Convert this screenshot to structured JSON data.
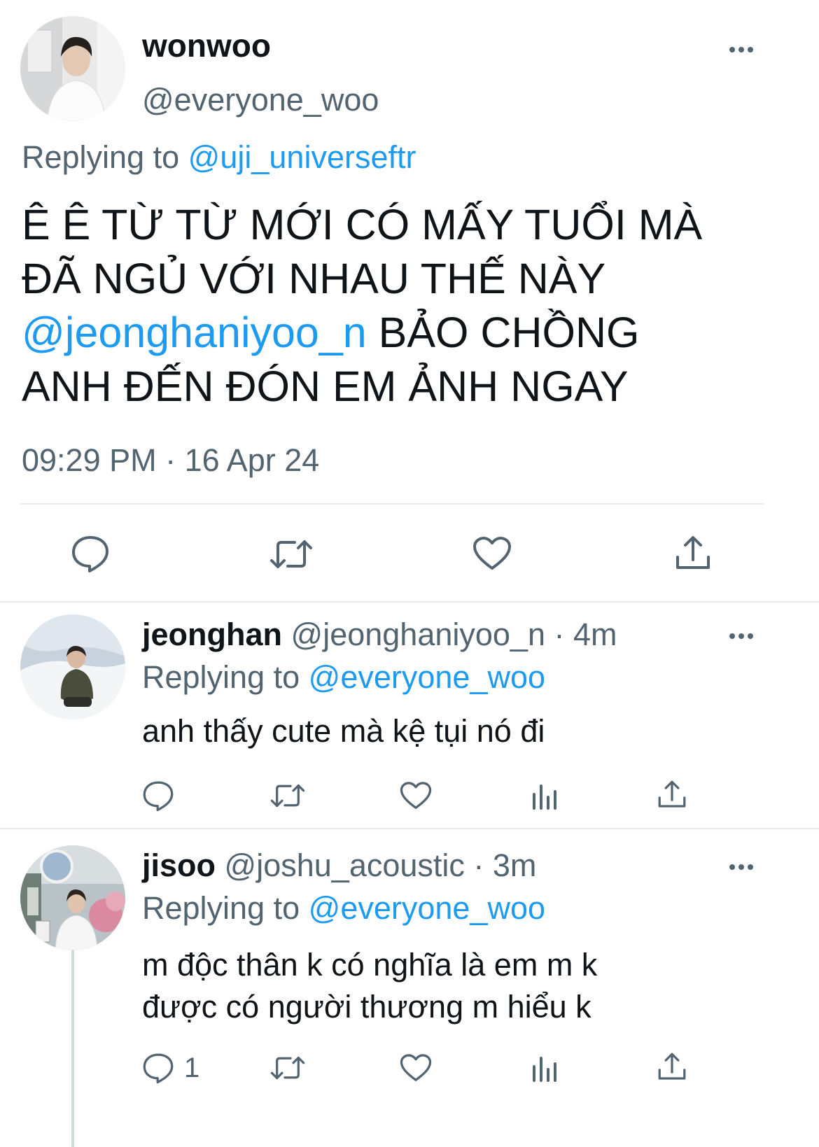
{
  "main_tweet": {
    "display_name": "wonwoo",
    "handle": "@everyone_woo",
    "replying_prefix": "Replying to",
    "replying_handle": "@uji_universeftr",
    "text_line1": "Ê Ê TỪ TỪ MỚI CÓ MẤY TUỔI MÀ",
    "text_line2": "ĐÃ NGỦ VỚI NHAU THẾ NÀY",
    "text_mention": "@jeonghaniyoo_n",
    "text_line3_rest": " BẢO CHỒNG",
    "text_line4": "ANH ĐẾN ĐÓN EM ẢNH NGAY",
    "timestamp": "09:29 PM · 16 Apr 24",
    "actions": [
      "reply-icon",
      "retweet-icon",
      "like-icon",
      "share-icon"
    ]
  },
  "replies": [
    {
      "display_name": "jeonghan",
      "handle": "@jeonghaniyoo_n",
      "time": "· 4m",
      "replying_prefix": "Replying to",
      "replying_handle": "@everyone_woo",
      "text_line1": "anh thấy cute mà kệ tụi nó đi",
      "reply_count": "",
      "actions": [
        "reply-icon",
        "retweet-icon",
        "like-icon",
        "analytics-icon",
        "share-icon"
      ]
    },
    {
      "display_name": "jisoo",
      "handle": "@joshu_acoustic",
      "time": "· 3m",
      "replying_prefix": "Replying to",
      "replying_handle": "@everyone_woo",
      "text_line1": "m độc thân k có nghĩa là em m k",
      "text_line2": "được có người thương m hiểu k",
      "reply_count": "1",
      "actions": [
        "reply-icon",
        "retweet-icon",
        "like-icon",
        "analytics-icon",
        "share-icon"
      ]
    }
  ],
  "colors": {
    "link": "#1d9bf0",
    "muted": "#536471",
    "text": "#0f1419",
    "divider": "#e7e9ec"
  }
}
